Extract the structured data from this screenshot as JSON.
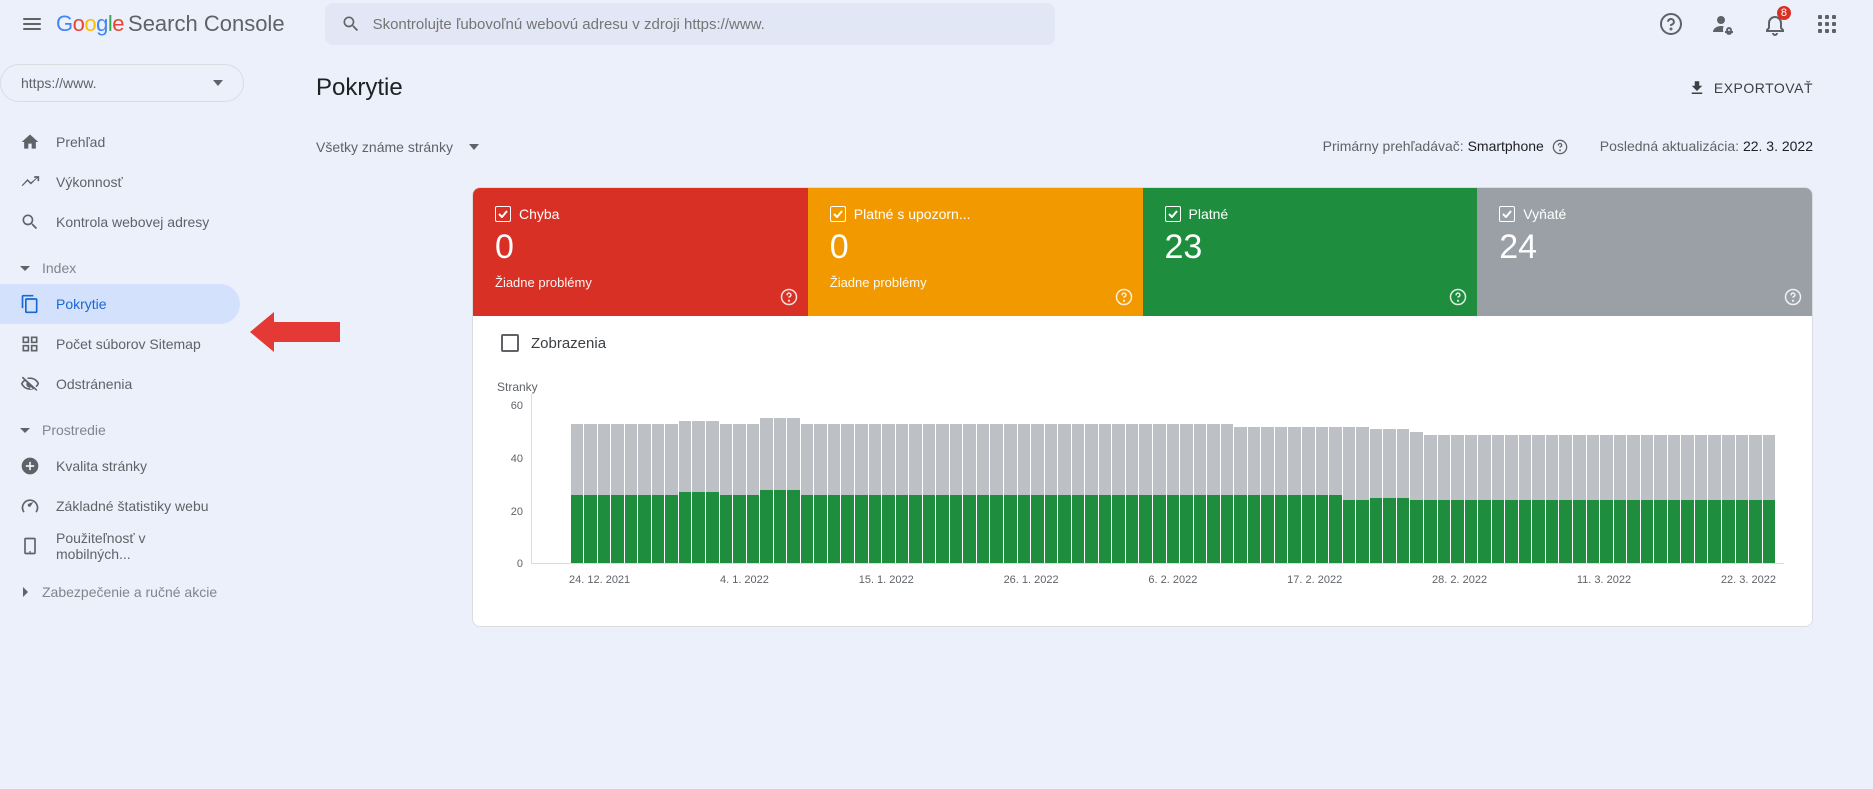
{
  "header": {
    "product": "Search Console",
    "search_placeholder": "Skontrolujte ľubovoľnú webovú adresu v zdroji https://www.",
    "notifications_count": "8"
  },
  "sidebar": {
    "property": "https://www.",
    "nav_top": [
      {
        "label": "Prehľad",
        "icon": "home"
      },
      {
        "label": "Výkonnosť",
        "icon": "chartline"
      },
      {
        "label": "Kontrola webovej adresy",
        "icon": "search"
      }
    ],
    "sections": [
      {
        "title": "Index",
        "items": [
          {
            "label": "Pokrytie",
            "icon": "copy",
            "active": true
          },
          {
            "label": "Počet súborov Sitemap",
            "icon": "sitemap"
          },
          {
            "label": "Odstránenia",
            "icon": "eyeoff"
          }
        ]
      },
      {
        "title": "Prostredie",
        "items": [
          {
            "label": "Kvalita stránky",
            "icon": "pluscircle"
          },
          {
            "label": "Základné štatistiky webu",
            "icon": "speedo"
          },
          {
            "label": "Použiteľnosť v mobilných...",
            "icon": "mobile"
          }
        ]
      },
      {
        "title": "Zabezpečenie a ručné akcie",
        "collapsed": true
      }
    ]
  },
  "main": {
    "title": "Pokrytie",
    "export": "EXPORTOVAŤ",
    "filter": "Všetky známe stránky",
    "crawler_label": "Primárny prehľadávač: ",
    "crawler_value": "Smartphone",
    "update_label": "Posledná aktualizácia: ",
    "update_value": "22. 3. 2022",
    "tiles": [
      {
        "label": "Chyba",
        "value": "0",
        "sub": "Žiadne problémy",
        "class": "tile-error"
      },
      {
        "label": "Platné s upozorn...",
        "value": "0",
        "sub": "Žiadne problémy",
        "class": "tile-warning"
      },
      {
        "label": "Platné",
        "value": "23",
        "sub": "",
        "class": "tile-valid"
      },
      {
        "label": "Vyňaté",
        "value": "24",
        "sub": "",
        "class": "tile-excluded"
      }
    ],
    "impressions": "Zobrazenia"
  },
  "chart_data": {
    "type": "bar",
    "title": "",
    "xlabel": "",
    "ylabel": "Stranky",
    "ylim": [
      0,
      60
    ],
    "y_ticks": [
      60,
      40,
      20,
      0
    ],
    "x_ticks": [
      "24. 12. 2021",
      "4. 1. 2022",
      "15. 1. 2022",
      "26. 1. 2022",
      "6. 2. 2022",
      "17. 2. 2022",
      "28. 2. 2022",
      "11. 3. 2022",
      "22. 3. 2022"
    ],
    "series": [
      {
        "name": "Platné",
        "color": "#1e8e3e",
        "values": [
          25,
          25,
          25,
          25,
          25,
          25,
          25,
          25,
          26,
          26,
          26,
          25,
          25,
          25,
          27,
          27,
          27,
          25,
          25,
          25,
          25,
          25,
          25,
          25,
          25,
          25,
          25,
          25,
          25,
          25,
          25,
          25,
          25,
          25,
          25,
          25,
          25,
          25,
          25,
          25,
          25,
          25,
          25,
          25,
          25,
          25,
          25,
          25,
          25,
          25,
          25,
          25,
          25,
          25,
          25,
          25,
          25,
          23,
          23,
          24,
          24,
          24,
          23,
          23,
          23,
          23,
          23,
          23,
          23,
          23,
          23,
          23,
          23,
          23,
          23,
          23,
          23,
          23,
          23,
          23,
          23,
          23,
          23,
          23,
          23,
          23,
          23,
          23,
          23
        ]
      },
      {
        "name": "Vyňaté",
        "color": "#bdc1c6",
        "values": [
          26,
          26,
          26,
          26,
          26,
          26,
          26,
          26,
          26,
          26,
          26,
          26,
          26,
          26,
          26,
          26,
          26,
          26,
          26,
          26,
          26,
          26,
          26,
          26,
          26,
          26,
          26,
          26,
          26,
          26,
          26,
          26,
          26,
          26,
          26,
          26,
          26,
          26,
          26,
          26,
          26,
          26,
          26,
          26,
          26,
          26,
          26,
          26,
          26,
          25,
          25,
          25,
          25,
          25,
          25,
          25,
          25,
          27,
          27,
          25,
          25,
          25,
          25,
          24,
          24,
          24,
          24,
          24,
          24,
          24,
          24,
          24,
          24,
          24,
          24,
          24,
          24,
          24,
          24,
          24,
          24,
          24,
          24,
          24,
          24,
          24,
          24,
          24,
          24
        ]
      }
    ]
  }
}
